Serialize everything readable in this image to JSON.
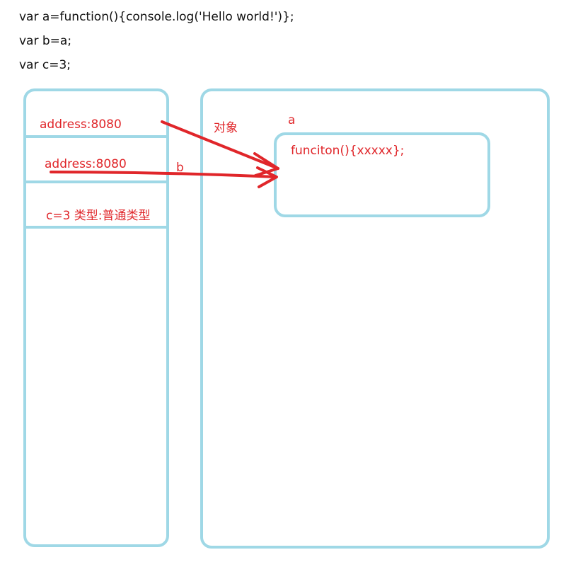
{
  "code": {
    "line1": "var a=function(){console.log('Hello world!')};",
    "line2": "var b=a;",
    "line3": "var c=3;"
  },
  "stack": {
    "row1": "address:8080",
    "row2": "address:8080",
    "row3": "c=3   类型:普通类型"
  },
  "heap": {
    "label": "对象",
    "object_label": "a",
    "object_content": "funciton(){xxxxx};"
  },
  "pointer_labels": {
    "b": "b"
  },
  "colors": {
    "frame": "#9fd8e6",
    "text_red": "#e0262a",
    "arrow": "#e0262a",
    "code_text": "#111111"
  }
}
